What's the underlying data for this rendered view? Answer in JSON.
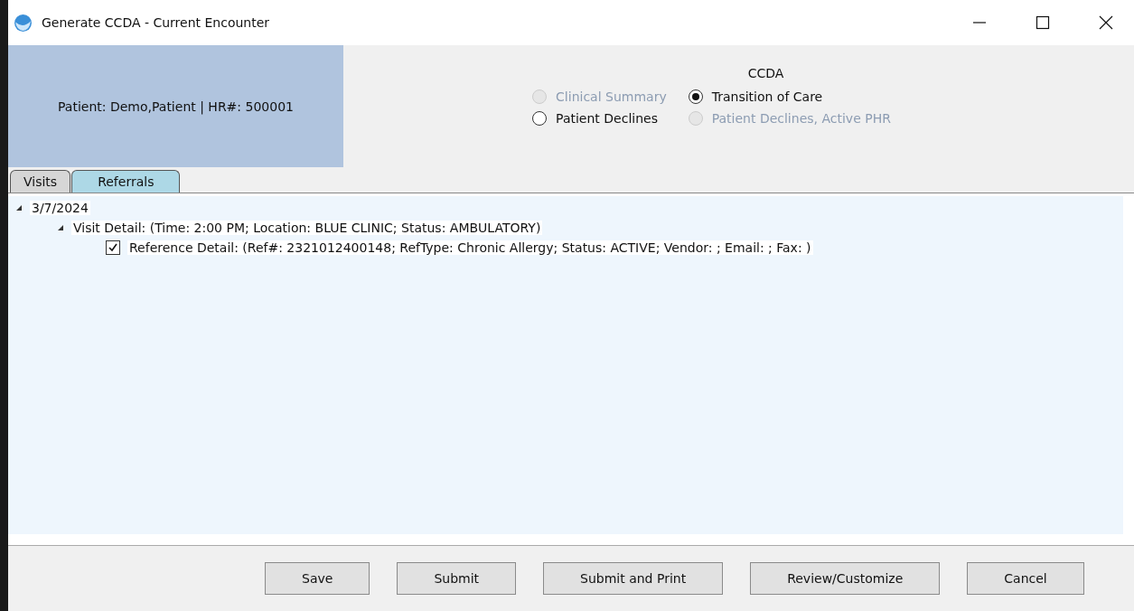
{
  "window": {
    "title": "Generate CCDA - Current Encounter"
  },
  "patient": {
    "label": "Patient: Demo,Patient | HR#: 500001"
  },
  "ccda": {
    "title": "CCDA",
    "options": [
      {
        "label": "Clinical Summary",
        "selected": false,
        "disabled": true
      },
      {
        "label": "Transition of Care",
        "selected": true,
        "disabled": false
      },
      {
        "label": "Patient Declines",
        "selected": false,
        "disabled": false
      },
      {
        "label": "Patient Declines, Active PHR",
        "selected": false,
        "disabled": true
      }
    ]
  },
  "tabs": [
    {
      "label": "Visits",
      "selected": false
    },
    {
      "label": "Referrals",
      "selected": true
    }
  ],
  "tree": [
    {
      "label": "3/7/2024",
      "expanded": true,
      "children": [
        {
          "label": "Visit Detail: (Time: 2:00 PM; Location: BLUE CLINIC; Status: AMBULATORY)",
          "expanded": true,
          "children": [
            {
              "label": "Reference Detail: (Ref#: 2321012400148; RefType: Chronic Allergy; Status: ACTIVE; Vendor: ; Email: ; Fax: )",
              "kind": "checkbox",
              "checked": true
            }
          ]
        }
      ]
    }
  ],
  "buttons": [
    "Save",
    "Submit",
    "Submit and Print",
    "Review/Customize",
    "Cancel"
  ]
}
